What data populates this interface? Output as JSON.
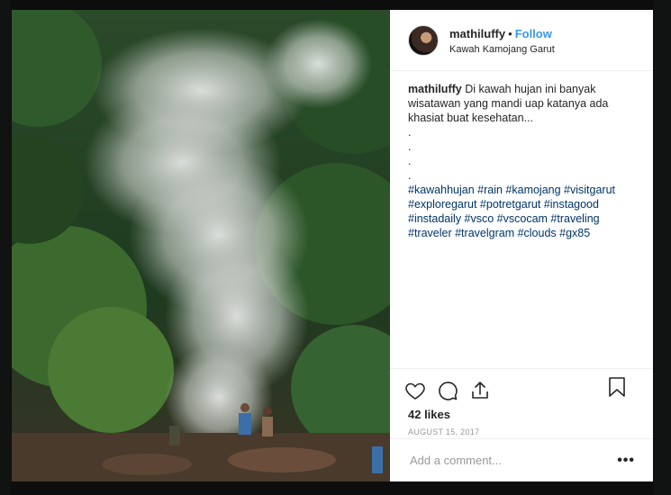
{
  "post": {
    "username": "mathiluffy",
    "separator": "•",
    "follow_label": "Follow",
    "location": "Kawah Kamojang Garut",
    "caption_user": "mathiluffy",
    "caption_text": "Di kawah hujan ini banyak wisatawan yang mandi uap katanya ada khasiat buat kesehatan...",
    "caption_dots": [
      ".",
      ".",
      ".",
      "."
    ],
    "hashtags": "#kawahhujan #rain #kamojang #visitgarut #exploregarut #potretgarut #instagood #instadaily #vsco #vscocam #traveling #traveler #travelgram #clouds #gx85",
    "likes": "42 likes",
    "date": "AUGUST 15, 2017",
    "comment_placeholder": "Add a comment...",
    "more_label": "•••"
  },
  "icons": {
    "like": "heart-icon",
    "comment": "speech-bubble-icon",
    "share": "share-icon",
    "save": "bookmark-icon"
  },
  "colors": {
    "follow": "#3897f0",
    "hashtag": "#003569",
    "text": "#262626",
    "muted": "#999999"
  }
}
